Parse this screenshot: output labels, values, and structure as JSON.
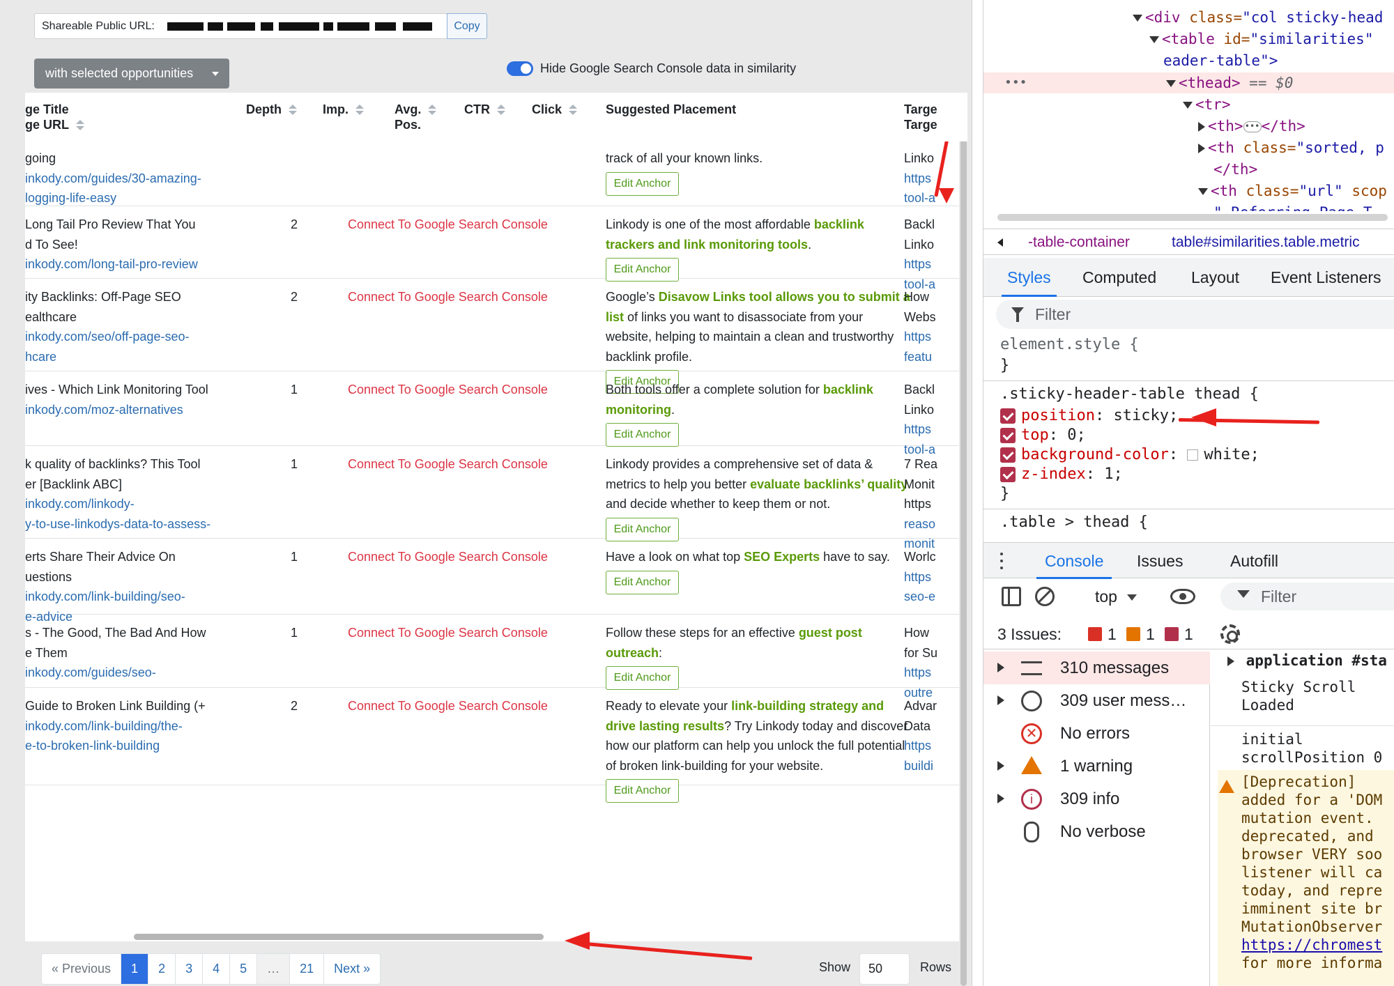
{
  "share": {
    "label": "Shareable Public URL:",
    "copy_label": "Copy"
  },
  "bulk_button": {
    "label": "with selected opportunities"
  },
  "toggle": {
    "label": "Hide Google Search Console data in similarity",
    "on": true
  },
  "table": {
    "headers": {
      "title_line1": "ge Title",
      "title_line2": "ge URL",
      "depth": "Depth",
      "imp": "Imp.",
      "avg_line1": "Avg.",
      "avg_line2": "Pos.",
      "ctr": "CTR",
      "click": "Click",
      "suggested": "Suggested Placement",
      "target_line1": "Targe",
      "target_line2": "Targe"
    },
    "edit_anchor_label": "Edit Anchor",
    "rows": [
      {
        "title": [
          "going"
        ],
        "url": [
          "inkody.com/guides/30-amazing-",
          "logging-life-easy"
        ],
        "depth": "",
        "gsc": "",
        "sugg_html": "track of all your known links.",
        "target": [
          "Linko",
          "https",
          "tool-a"
        ]
      },
      {
        "title": [
          " Long Tail Pro Review That You",
          "d To See!"
        ],
        "url": [
          "inkody.com/long-tail-pro-review"
        ],
        "depth": "2",
        "gsc": "Connect To Google Search Console",
        "sugg_html": "Linkody is one of the most affordable <b>backlink trackers and link monitoring tools</b>.",
        "target": [
          "Backl",
          "Linko",
          "https",
          "tool-a"
        ]
      },
      {
        "title": [
          "ity Backlinks: Off-Page SEO",
          "ealthcare"
        ],
        "url": [
          "inkody.com/seo/off-page-seo-",
          "hcare"
        ],
        "depth": "2",
        "gsc": "Connect To Google Search Console",
        "sugg_html": "Google’s <b>Disavow Links tool allows you to submit a list</b> of links you want to disassociate from your website, helping to maintain a clean and trustworthy backlink profile.",
        "target": [
          "How",
          "Webs",
          "https",
          "featu"
        ]
      },
      {
        "title": [
          "ives - Which Link Monitoring Tool",
          ""
        ],
        "url": [
          "inkody.com/moz-alternatives"
        ],
        "depth": "1",
        "gsc": "Connect To Google Search Console",
        "sugg_html": "Both tools offer a complete solution for <b>backlink monitoring</b>.",
        "target": [
          "Backl",
          "Linko",
          "https",
          "tool-a"
        ]
      },
      {
        "title": [
          "k quality of backlinks? This Tool",
          "er [Backlink ABC]"
        ],
        "url": [
          "inkody.com/linkody-",
          "y-to-use-linkodys-data-to-assess-"
        ],
        "depth": "1",
        "gsc": "Connect To Google Search Console",
        "sugg_html": "Linkody provides a comprehensive set of data &amp; metrics to help you better <b>evaluate backlinks’ quality</b> and decide whether to keep them or not.",
        "target": [
          "7 Rea",
          "Monit",
          "https",
          "reaso",
          "monit"
        ]
      },
      {
        "title": [
          "erts Share Their Advice On",
          "uestions"
        ],
        "url": [
          "inkody.com/link-building/seo-",
          "e-advice"
        ],
        "depth": "1",
        "gsc": "Connect To Google Search Console",
        "sugg_html": "Have a look on what top <b>SEO Experts</b> have to say.",
        "target": [
          "Worlc",
          "https",
          "seo-e"
        ]
      },
      {
        "title": [
          "s - The Good, The Bad And How",
          "e Them"
        ],
        "url": [
          "inkody.com/guides/seo-"
        ],
        "depth": "1",
        "gsc": "Connect To Google Search Console",
        "sugg_html": "Follow these steps for an effective <b>guest post outreach</b>:",
        "target": [
          "How",
          "for Su",
          "https",
          "outre"
        ]
      },
      {
        "title": [
          " Guide to Broken Link Building (+",
          ""
        ],
        "url": [
          "inkody.com/link-building/the-",
          "e-to-broken-link-building"
        ],
        "depth": "2",
        "gsc": "Connect To Google Search Console",
        "sugg_html": "Ready to elevate your <b>link-building strategy and drive lasting results</b>? Try Linkody today and discover how our platform can help you unlock the full potential of broken link-building for your website.",
        "target": [
          "Advar",
          "Data",
          "https",
          "buildi"
        ]
      }
    ]
  },
  "pagination": {
    "prev": "« Previous",
    "pages": [
      "1",
      "2",
      "3",
      "4",
      "5",
      "…",
      "21"
    ],
    "active": "1",
    "next": "Next »"
  },
  "rows_control": {
    "show": "Show",
    "value": "50",
    "rows": "Rows"
  },
  "devtools": {
    "dom": {
      "line1_tag": "<div",
      "line1_attr": "class=",
      "line1_val": "\"col sticky-head",
      "line2_tag": "<table",
      "line2_attr": "id=",
      "line2_val": "\"similarities\"",
      "line2b": "eader-table\">",
      "thead_tag": "<thead>",
      "thead_suffix": "== $0",
      "tr_tag": "<tr>",
      "th1": "<th>",
      "th1_end": "</th>",
      "th2_tag": "<th",
      "th2_attr": "class=",
      "th2_val": "\"sorted, p",
      "th2_end": "</th>",
      "th3_tag": "<th",
      "th3_attr": "class=",
      "th3_val": "\"url\"",
      "th3_attr2": "scop",
      "th3_next": "\" Referring Page T"
    },
    "breadcrumb": [
      "-table-container",
      "table#similarities.table.metric"
    ],
    "style_tabs": [
      "Styles",
      "Computed",
      "Layout",
      "Event Listeners"
    ],
    "styles_filter": "Filter",
    "rules": {
      "element_style": "element.style {",
      "close": "}",
      "sticky_selector": ".sticky-header-table thead {",
      "props": [
        {
          "name": "position",
          "value": "sticky;"
        },
        {
          "name": "top",
          "value": "0;"
        },
        {
          "name": "background-color",
          "value": "white;"
        },
        {
          "name": "z-index",
          "value": "1;"
        }
      ],
      "table_thead": ".table > thead {"
    },
    "console_tabs": [
      "Console",
      "Issues",
      "Autofill"
    ],
    "context": "top",
    "console_filter": "Filter",
    "issues": {
      "label": "3 Issues:",
      "errors": "1",
      "warnings": "1",
      "info": "1"
    },
    "sidebar": [
      {
        "label": "310 messages"
      },
      {
        "label": "309 user mess…"
      },
      {
        "label": "No errors"
      },
      {
        "label": "1 warning"
      },
      {
        "label": "309 info"
      },
      {
        "label": "No verbose"
      }
    ],
    "log": {
      "application": "application #sta",
      "sticky1": "Sticky Scroll",
      "sticky2": "Loaded",
      "initial1": "initial",
      "initial2": "scrollPosition 0",
      "warn_lines": [
        "[Deprecation]",
        "added for a 'DOM",
        "mutation event.",
        "deprecated, and",
        "browser VERY soo",
        "listener will ca",
        "today, and repre",
        "imminent site br",
        "MutationObserver"
      ],
      "warn_link": "https://chromest",
      "warn_tail": "for more informa"
    }
  },
  "colors": {
    "accent": "#2d6ee0",
    "link": "#2b6cb0",
    "gsc_red": "#dc3545",
    "keyword_green": "#5a9a08",
    "annotation_red": "#e8211d"
  }
}
